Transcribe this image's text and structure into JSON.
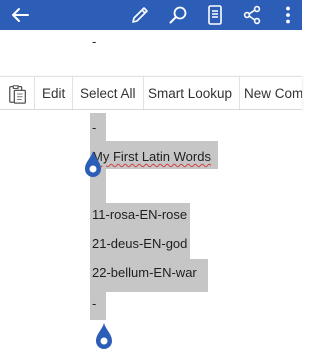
{
  "toolbar": {
    "icons": [
      "back-arrow-icon",
      "pen-icon",
      "search-icon",
      "reading-view-icon",
      "share-icon",
      "more-icon"
    ],
    "accent": "#2c5eb8"
  },
  "doc_top_dash": "-",
  "context_menu": {
    "items": [
      "Edit",
      "Select All",
      "Smart Lookup",
      "New Com"
    ]
  },
  "document": {
    "lines": [
      "-",
      "My First Latin Words",
      "",
      "11-rosa-EN-rose",
      "21-deus-EN-god",
      "22-bellum-EN-war",
      "-"
    ],
    "selection_color": "#c6c6c6",
    "handle_color": "#2c5eb8"
  }
}
